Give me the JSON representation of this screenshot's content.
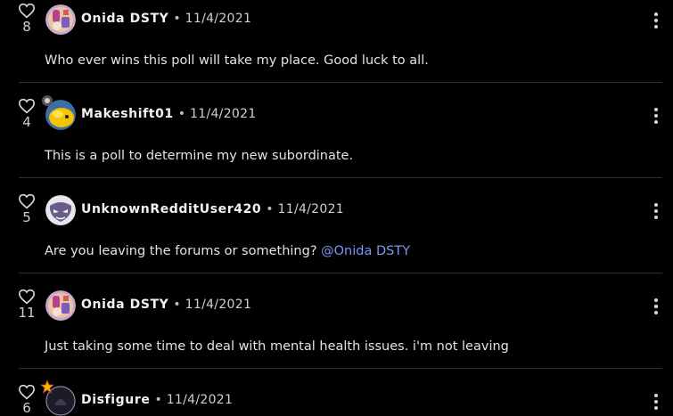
{
  "comments": [
    {
      "likes": "8",
      "username": "Onida DSTY",
      "date": "11/4/2021",
      "text": "Who ever wins this poll will take my place. Good luck to all.",
      "mention": ""
    },
    {
      "likes": "4",
      "username": "Makeshift01",
      "date": "11/4/2021",
      "text": "This is a poll to determine my new subordinate.",
      "mention": ""
    },
    {
      "likes": "5",
      "username": "UnknownRedditUser420",
      "date": "11/4/2021",
      "text": "Are you leaving the forums or something? ",
      "mention": "@Onida DSTY"
    },
    {
      "likes": "11",
      "username": "Onida DSTY",
      "date": "11/4/2021",
      "text": "Just taking some time to deal with mental health issues. i'm not leaving",
      "mention": ""
    },
    {
      "likes": "6",
      "username": "Disfigure",
      "date": "11/4/2021",
      "text": "",
      "mention": ""
    }
  ],
  "separator": "•",
  "colors": {
    "background": "#000000",
    "mention": "#7e95f5",
    "badge_star": "#f0b800"
  },
  "icons": {
    "like": "heart-icon",
    "menu": "more-options-icon"
  }
}
